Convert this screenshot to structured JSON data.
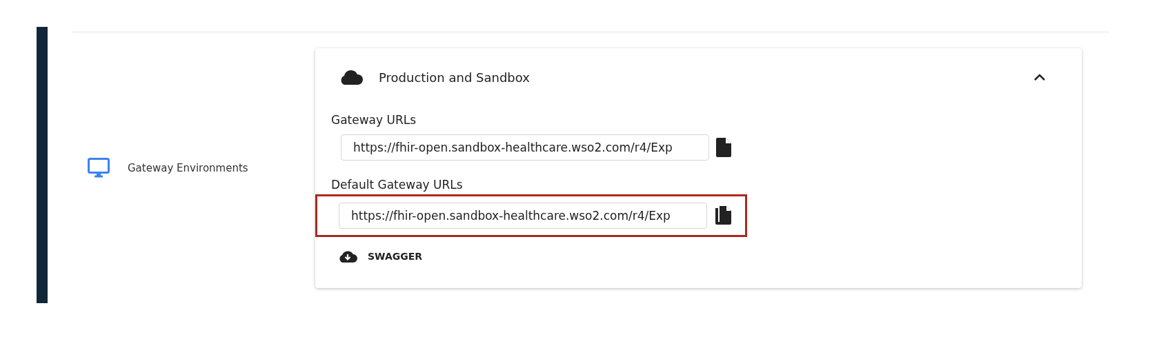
{
  "section": {
    "label": "Gateway Environments"
  },
  "environment": {
    "title": "Production and Sandbox",
    "expanded": true,
    "url_groups": [
      {
        "label": "Gateway URLs",
        "value": "https://fhir-open.sandbox-healthcare.wso2.com/r4/Exp",
        "copied": false,
        "highlighted": false
      },
      {
        "label": "Default Gateway URLs",
        "value": "https://fhir-open.sandbox-healthcare.wso2.com/r4/Exp",
        "copied": true,
        "highlighted": true
      }
    ],
    "swagger": "SWAGGER"
  }
}
